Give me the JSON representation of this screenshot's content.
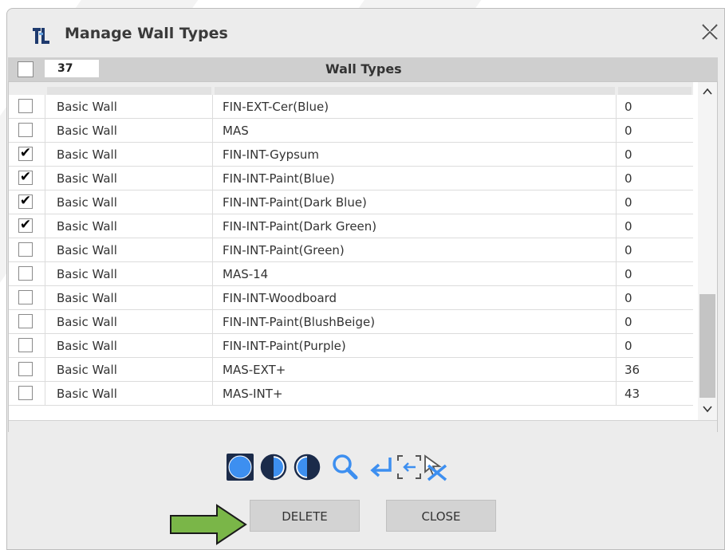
{
  "window": {
    "title": "Manage Wall Types",
    "app_icon": "app-logo-icon",
    "close_icon": "close-icon"
  },
  "header": {
    "count": "37",
    "title": "Wall Types"
  },
  "table": {
    "rows": [
      {
        "checked": false,
        "type": "Basic Wall",
        "name": "FIN-EXT-Cer(Blue)",
        "count": "0"
      },
      {
        "checked": false,
        "type": "Basic Wall",
        "name": "MAS",
        "count": "0"
      },
      {
        "checked": true,
        "type": "Basic Wall",
        "name": "FIN-INT-Gypsum",
        "count": "0"
      },
      {
        "checked": true,
        "type": "Basic Wall",
        "name": "FIN-INT-Paint(Blue)",
        "count": "0"
      },
      {
        "checked": true,
        "type": "Basic Wall",
        "name": "FIN-INT-Paint(Dark Blue)",
        "count": "0"
      },
      {
        "checked": true,
        "type": "Basic Wall",
        "name": "FIN-INT-Paint(Dark Green)",
        "count": "0"
      },
      {
        "checked": false,
        "type": "Basic Wall",
        "name": "FIN-INT-Paint(Green)",
        "count": "0"
      },
      {
        "checked": false,
        "type": "Basic Wall",
        "name": "MAS-14",
        "count": "0"
      },
      {
        "checked": false,
        "type": "Basic Wall",
        "name": "FIN-INT-Woodboard",
        "count": "0"
      },
      {
        "checked": false,
        "type": "Basic Wall",
        "name": "FIN-INT-Paint(BlushBeige)",
        "count": "0"
      },
      {
        "checked": false,
        "type": "Basic Wall",
        "name": "FIN-INT-Paint(Purple)",
        "count": "0"
      },
      {
        "checked": false,
        "type": "Basic Wall",
        "name": "MAS-EXT+",
        "count": "36"
      },
      {
        "checked": false,
        "type": "Basic Wall",
        "name": "MAS-INT+",
        "count": "43"
      }
    ]
  },
  "scroll": {
    "up": "^",
    "down": "v"
  },
  "toolbar": {
    "icons": [
      "select-all-icon",
      "select-half-left-icon",
      "select-half-right-icon",
      "search-icon",
      "enter-arrow-icon",
      "frame-select-icon",
      "clear-selection-icon"
    ]
  },
  "buttons": {
    "delete": "DELETE",
    "close": "CLOSE"
  },
  "colors": {
    "accent_blue": "#3d8ff0",
    "arrow_green": "#7ab648",
    "button_bg": "#d3d3d3"
  }
}
